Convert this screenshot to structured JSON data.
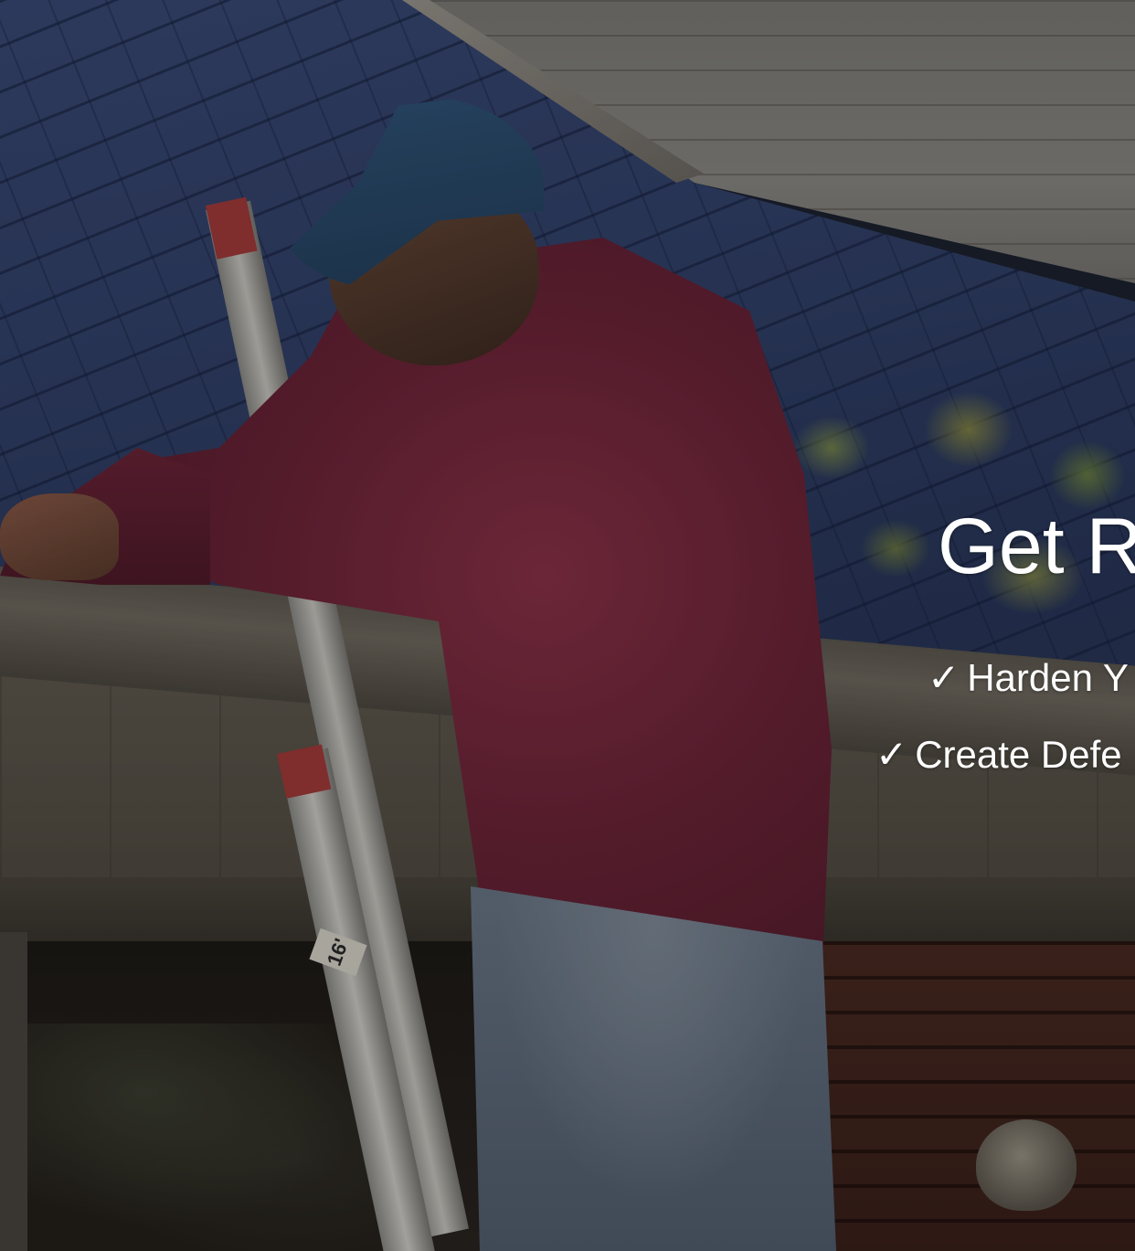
{
  "headline": "Get R",
  "bullets": [
    {
      "check": "✓",
      "text": "Harden Y"
    },
    {
      "check": "✓",
      "text": "Create Defe"
    }
  ],
  "ladder_label": "16'"
}
